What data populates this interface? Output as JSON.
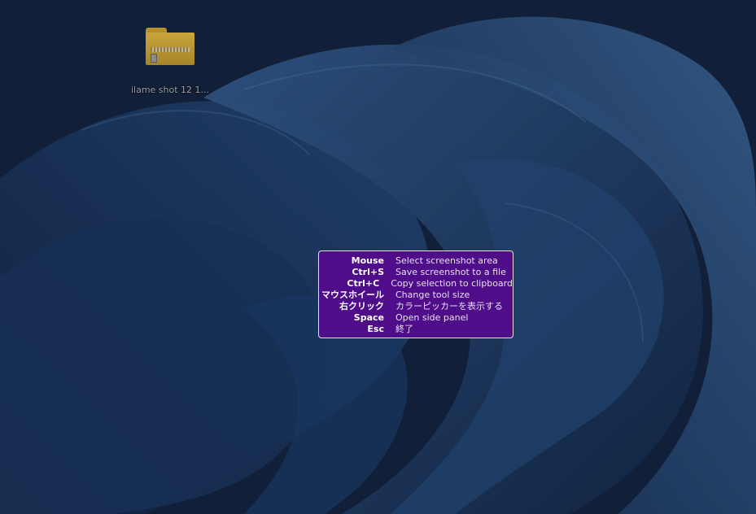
{
  "desktop": {
    "icon": {
      "name": "zip-folder-icon",
      "label": "ilame shot 12 1..."
    }
  },
  "help_panel": {
    "accent_color": "#4f0d8a",
    "rows": [
      {
        "key": "Mouse",
        "desc": "Select screenshot area"
      },
      {
        "key": "Ctrl+S",
        "desc": "Save screenshot to a file"
      },
      {
        "key": "Ctrl+C",
        "desc": "Copy selection to clipboard"
      },
      {
        "key": "マウスホイール",
        "desc": "Change tool size"
      },
      {
        "key": "右クリック",
        "desc": "カラーピッカーを表示する"
      },
      {
        "key": "Space",
        "desc": "Open side panel"
      },
      {
        "key": "Esc",
        "desc": "終了"
      }
    ]
  }
}
